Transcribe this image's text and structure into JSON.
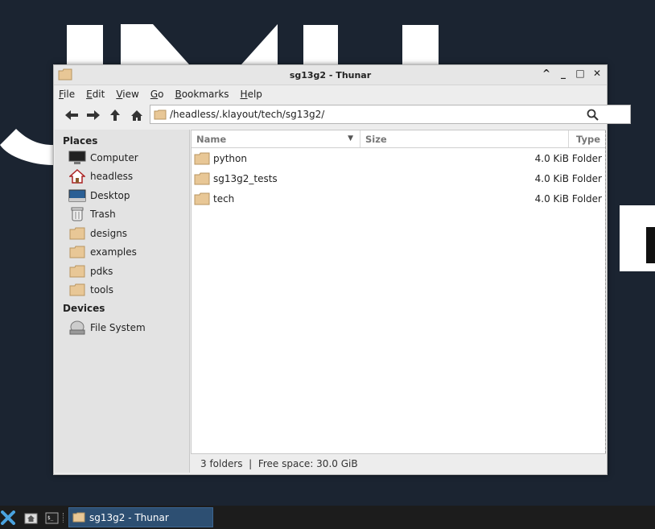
{
  "window": {
    "title": "sg13g2 - Thunar",
    "controls": [
      "^",
      "_",
      "□",
      "✕"
    ]
  },
  "menubar": {
    "items": [
      {
        "label": "File",
        "mnemonic": "F",
        "rest": "ile"
      },
      {
        "label": "Edit",
        "mnemonic": "E",
        "rest": "dit"
      },
      {
        "label": "View",
        "mnemonic": "V",
        "rest": "iew"
      },
      {
        "label": "Go",
        "mnemonic": "G",
        "rest": "o"
      },
      {
        "label": "Bookmarks",
        "mnemonic": "B",
        "rest": "ookmarks"
      },
      {
        "label": "Help",
        "mnemonic": "H",
        "rest": "elp"
      }
    ]
  },
  "toolbar": {
    "location_path": "/headless/.klayout/tech/sg13g2/",
    "icons": [
      "back-arrow-icon",
      "forward-arrow-icon",
      "up-arrow-icon",
      "home-icon",
      "search-icon"
    ]
  },
  "sidebar": {
    "places_header": "Places",
    "places": [
      {
        "label": "Computer",
        "icon": "computer-icon"
      },
      {
        "label": "headless",
        "icon": "home-icon"
      },
      {
        "label": "Desktop",
        "icon": "desktop-icon"
      },
      {
        "label": "Trash",
        "icon": "trash-icon"
      },
      {
        "label": "designs",
        "icon": "folder-icon"
      },
      {
        "label": "examples",
        "icon": "folder-icon"
      },
      {
        "label": "pdks",
        "icon": "folder-icon"
      },
      {
        "label": "tools",
        "icon": "folder-icon"
      }
    ],
    "devices_header": "Devices",
    "devices": [
      {
        "label": "File System",
        "icon": "drive-icon"
      }
    ]
  },
  "filelist": {
    "columns": {
      "name": "Name",
      "size": "Size",
      "type": "Type"
    },
    "rows": [
      {
        "name": "python",
        "size": "4.0 KiB",
        "type": "Folder"
      },
      {
        "name": "sg13g2_tests",
        "size": "4.0 KiB",
        "type": "Folder"
      },
      {
        "name": "tech",
        "size": "4.0 KiB",
        "type": "Folder"
      }
    ]
  },
  "statusbar": {
    "text": "3 folders  |  Free space: 30.0 GiB"
  },
  "taskbar": {
    "task_label": "sg13g2 - Thunar"
  },
  "colors": {
    "desktop_bg": "#1b2431",
    "folder_tan": "#e8c796",
    "taskbar_active": "#2d4f72"
  }
}
